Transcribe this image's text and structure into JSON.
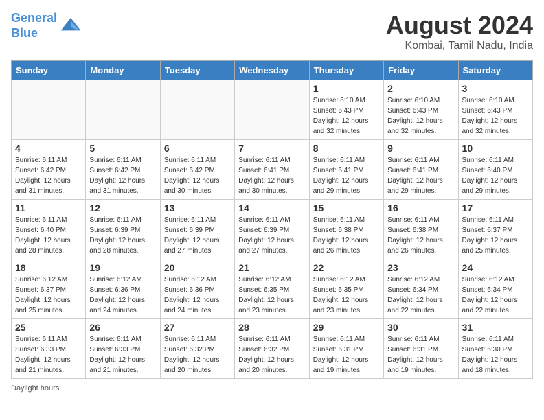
{
  "header": {
    "logo_line1": "General",
    "logo_line2": "Blue",
    "month_year": "August 2024",
    "location": "Kombai, Tamil Nadu, India"
  },
  "days_of_week": [
    "Sunday",
    "Monday",
    "Tuesday",
    "Wednesday",
    "Thursday",
    "Friday",
    "Saturday"
  ],
  "weeks": [
    [
      {
        "day": "",
        "info": ""
      },
      {
        "day": "",
        "info": ""
      },
      {
        "day": "",
        "info": ""
      },
      {
        "day": "",
        "info": ""
      },
      {
        "day": "1",
        "info": "Sunrise: 6:10 AM\nSunset: 6:43 PM\nDaylight: 12 hours\nand 32 minutes."
      },
      {
        "day": "2",
        "info": "Sunrise: 6:10 AM\nSunset: 6:43 PM\nDaylight: 12 hours\nand 32 minutes."
      },
      {
        "day": "3",
        "info": "Sunrise: 6:10 AM\nSunset: 6:43 PM\nDaylight: 12 hours\nand 32 minutes."
      }
    ],
    [
      {
        "day": "4",
        "info": "Sunrise: 6:11 AM\nSunset: 6:42 PM\nDaylight: 12 hours\nand 31 minutes."
      },
      {
        "day": "5",
        "info": "Sunrise: 6:11 AM\nSunset: 6:42 PM\nDaylight: 12 hours\nand 31 minutes."
      },
      {
        "day": "6",
        "info": "Sunrise: 6:11 AM\nSunset: 6:42 PM\nDaylight: 12 hours\nand 30 minutes."
      },
      {
        "day": "7",
        "info": "Sunrise: 6:11 AM\nSunset: 6:41 PM\nDaylight: 12 hours\nand 30 minutes."
      },
      {
        "day": "8",
        "info": "Sunrise: 6:11 AM\nSunset: 6:41 PM\nDaylight: 12 hours\nand 29 minutes."
      },
      {
        "day": "9",
        "info": "Sunrise: 6:11 AM\nSunset: 6:41 PM\nDaylight: 12 hours\nand 29 minutes."
      },
      {
        "day": "10",
        "info": "Sunrise: 6:11 AM\nSunset: 6:40 PM\nDaylight: 12 hours\nand 29 minutes."
      }
    ],
    [
      {
        "day": "11",
        "info": "Sunrise: 6:11 AM\nSunset: 6:40 PM\nDaylight: 12 hours\nand 28 minutes."
      },
      {
        "day": "12",
        "info": "Sunrise: 6:11 AM\nSunset: 6:39 PM\nDaylight: 12 hours\nand 28 minutes."
      },
      {
        "day": "13",
        "info": "Sunrise: 6:11 AM\nSunset: 6:39 PM\nDaylight: 12 hours\nand 27 minutes."
      },
      {
        "day": "14",
        "info": "Sunrise: 6:11 AM\nSunset: 6:39 PM\nDaylight: 12 hours\nand 27 minutes."
      },
      {
        "day": "15",
        "info": "Sunrise: 6:11 AM\nSunset: 6:38 PM\nDaylight: 12 hours\nand 26 minutes."
      },
      {
        "day": "16",
        "info": "Sunrise: 6:11 AM\nSunset: 6:38 PM\nDaylight: 12 hours\nand 26 minutes."
      },
      {
        "day": "17",
        "info": "Sunrise: 6:11 AM\nSunset: 6:37 PM\nDaylight: 12 hours\nand 25 minutes."
      }
    ],
    [
      {
        "day": "18",
        "info": "Sunrise: 6:12 AM\nSunset: 6:37 PM\nDaylight: 12 hours\nand 25 minutes."
      },
      {
        "day": "19",
        "info": "Sunrise: 6:12 AM\nSunset: 6:36 PM\nDaylight: 12 hours\nand 24 minutes."
      },
      {
        "day": "20",
        "info": "Sunrise: 6:12 AM\nSunset: 6:36 PM\nDaylight: 12 hours\nand 24 minutes."
      },
      {
        "day": "21",
        "info": "Sunrise: 6:12 AM\nSunset: 6:35 PM\nDaylight: 12 hours\nand 23 minutes."
      },
      {
        "day": "22",
        "info": "Sunrise: 6:12 AM\nSunset: 6:35 PM\nDaylight: 12 hours\nand 23 minutes."
      },
      {
        "day": "23",
        "info": "Sunrise: 6:12 AM\nSunset: 6:34 PM\nDaylight: 12 hours\nand 22 minutes."
      },
      {
        "day": "24",
        "info": "Sunrise: 6:12 AM\nSunset: 6:34 PM\nDaylight: 12 hours\nand 22 minutes."
      }
    ],
    [
      {
        "day": "25",
        "info": "Sunrise: 6:11 AM\nSunset: 6:33 PM\nDaylight: 12 hours\nand 21 minutes."
      },
      {
        "day": "26",
        "info": "Sunrise: 6:11 AM\nSunset: 6:33 PM\nDaylight: 12 hours\nand 21 minutes."
      },
      {
        "day": "27",
        "info": "Sunrise: 6:11 AM\nSunset: 6:32 PM\nDaylight: 12 hours\nand 20 minutes."
      },
      {
        "day": "28",
        "info": "Sunrise: 6:11 AM\nSunset: 6:32 PM\nDaylight: 12 hours\nand 20 minutes."
      },
      {
        "day": "29",
        "info": "Sunrise: 6:11 AM\nSunset: 6:31 PM\nDaylight: 12 hours\nand 19 minutes."
      },
      {
        "day": "30",
        "info": "Sunrise: 6:11 AM\nSunset: 6:31 PM\nDaylight: 12 hours\nand 19 minutes."
      },
      {
        "day": "31",
        "info": "Sunrise: 6:11 AM\nSunset: 6:30 PM\nDaylight: 12 hours\nand 18 minutes."
      }
    ]
  ],
  "footer": {
    "note": "Daylight hours"
  }
}
